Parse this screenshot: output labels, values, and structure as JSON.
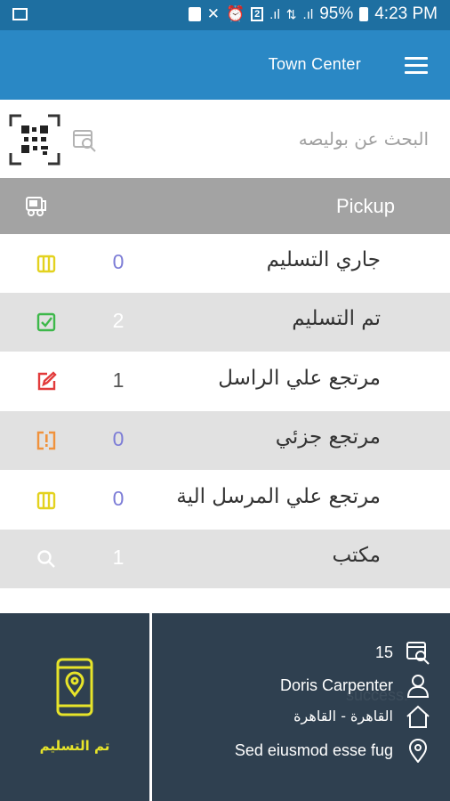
{
  "status_bar": {
    "battery": "95%",
    "time": "4:23 PM",
    "icons": [
      "gallery-icon",
      "lock-icon",
      "mute-icon",
      "alarm-icon",
      "sim-icon",
      "signal-icon",
      "data-icon",
      "battery-icon"
    ],
    "sim_label": "2"
  },
  "header": {
    "title": "Town Center",
    "menu_icon": "hamburger-menu-icon"
  },
  "search": {
    "placeholder": "البحث عن بوليصه",
    "qr_icon": "qr-scan-icon",
    "search_icon": "search-package-icon"
  },
  "section": {
    "label": "Pickup",
    "icon": "truck-icon"
  },
  "rows": [
    {
      "label": "جاري التسليم",
      "count": "0",
      "icon": "parcel-icon",
      "icon_color": "#e3d21f",
      "count_color": "#7c7cd6"
    },
    {
      "label": "تم التسليم",
      "count": "2",
      "icon": "check-icon",
      "icon_color": "#3db84a",
      "count_color": "#ffffff"
    },
    {
      "label": "مرتجع علي الراسل",
      "count": "1",
      "icon": "edit-icon",
      "icon_color": "#e23b3b",
      "count_color": "#555555"
    },
    {
      "label": "مرتجع جزئي",
      "count": "0",
      "icon": "warning-box-icon",
      "icon_color": "#f0923c",
      "count_color": "#7c7cd6"
    },
    {
      "label": "مرتجع علي المرسل الية",
      "count": "0",
      "icon": "parcel-icon",
      "icon_color": "#e3d21f",
      "count_color": "#7c7cd6"
    },
    {
      "label": "مكتب",
      "count": "1",
      "icon": "search-icon",
      "icon_color": "#ffffff",
      "count_color": "#ffffff"
    }
  ],
  "bottom": {
    "delivered_label": "تم التسليم",
    "delivered_icon": "phone-location-icon",
    "watermark": "success.",
    "info": {
      "id": "15",
      "name": "Doris Carpenter",
      "city": "القاهرة - القاهرة",
      "address": "Sed eiusmod esse fug"
    }
  },
  "colors": {
    "status_bar": "#1e6fa1",
    "header": "#2a88c5",
    "section_header": "#a3a3a3",
    "bottom_panel": "#2f4050",
    "accent_yellow": "#e7e42a"
  }
}
